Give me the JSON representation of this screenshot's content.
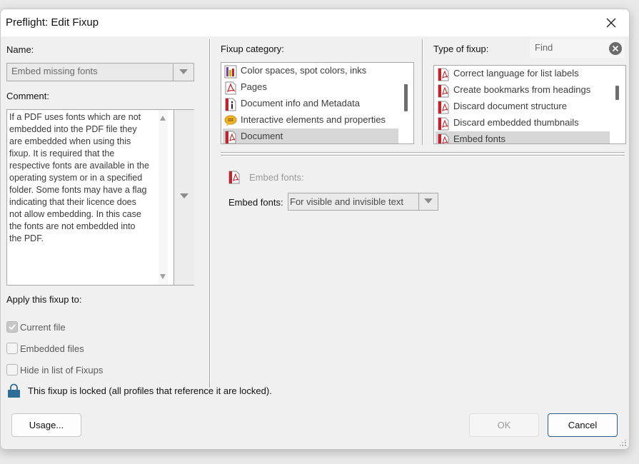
{
  "dialog": {
    "title": "Preflight: Edit Fixup"
  },
  "name_field": {
    "label": "Name:",
    "value": "Embed missing fonts"
  },
  "comment": {
    "label": "Comment:",
    "text": "If a PDF uses fonts which are not\nembedded into the PDF file they\nare embedded when using this\nfixup. It is required that the\nrespective fonts are available in the\noperating system or in a specified\nfolder. Some fonts may have a flag\nindicating that their licence does\nnot allow embedding. In this case\nthe fonts are not embedded into\nthe PDF."
  },
  "apply": {
    "label": "Apply this fixup to:",
    "options": [
      {
        "label": "Current file",
        "checked": true
      },
      {
        "label": "Embedded files",
        "checked": false
      },
      {
        "label": "Hide in list of Fixups",
        "checked": false
      }
    ]
  },
  "lock_message": "This fixup is locked (all profiles that reference it are locked).",
  "fixup_category": {
    "label": "Fixup category:",
    "items": [
      {
        "label": "Color spaces, spot colors, inks",
        "icon": "color-spaces-icon"
      },
      {
        "label": "Pages",
        "icon": "pdf-page-icon"
      },
      {
        "label": "Document info and Metadata",
        "icon": "info-icon"
      },
      {
        "label": "Interactive elements and properties",
        "icon": "comment-bubble-icon"
      },
      {
        "label": "Document",
        "icon": "pdf-document-icon",
        "selected": true
      }
    ]
  },
  "type_of_fixup": {
    "label": "Type of fixup:",
    "find_placeholder": "Find",
    "items": [
      {
        "label": "Correct language for list labels",
        "icon": "pdf-icon"
      },
      {
        "label": "Create bookmarks from headings",
        "icon": "pdf-icon"
      },
      {
        "label": "Discard document structure",
        "icon": "pdf-icon"
      },
      {
        "label": "Discard embedded thumbnails",
        "icon": "pdf-icon"
      },
      {
        "label": "Embed fonts",
        "icon": "pdf-icon",
        "selected": true
      }
    ]
  },
  "details": {
    "header": "Embed fonts:",
    "param_label": "Embed fonts:",
    "param_value": "For visible and invisible text"
  },
  "buttons": {
    "usage": "Usage...",
    "ok": "OK",
    "cancel": "Cancel"
  },
  "colors": {
    "selection": "#d7d7d7",
    "primary_border": "#2b5c8a",
    "pdf_red": "#c8202a"
  }
}
